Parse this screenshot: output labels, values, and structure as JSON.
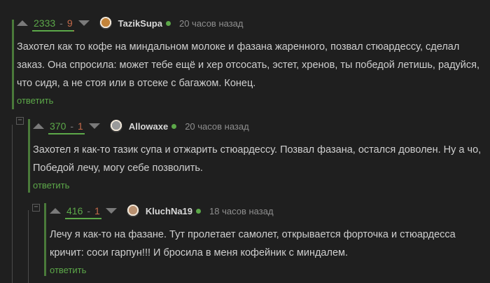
{
  "comments": [
    {
      "rating_up": "2333",
      "rating_sep": "-",
      "rating_down": "9",
      "rating_fraction": 0.996,
      "username": "TazikSupa",
      "time": "20 часов назад",
      "text_lines": [
        "Захотел как то кофе на миндальном молоке и фазана жаренного, позвал стюардессу, сделал",
        "заказ. Она спросила: может тебе ещё и хер отсосать, эстет, хренов, ты победой летишь, радуйся,",
        "что сидя, а не стоя или в отсеке с багажом. Конец."
      ],
      "reply_label": "ответить",
      "avatar_color": "#c4843a"
    },
    {
      "rating_up": "370",
      "rating_sep": "-",
      "rating_down": "1",
      "rating_fraction": 0.997,
      "username": "Allowaxe",
      "time": "20 часов назад",
      "text_lines": [
        "Захотел я как-то тазик супа и отжарить стюардессу. Позвал фазана, остался доволен. Ну а чо,",
        "Победой лечу, могу себе позволить."
      ],
      "reply_label": "ответить",
      "avatar_color": "#9a9a9a"
    },
    {
      "rating_up": "416",
      "rating_sep": "-",
      "rating_down": "1",
      "rating_fraction": 0.998,
      "username": "KluchNa19",
      "time": "18 часов назад",
      "text_lines": [
        "Лечу я как-то на фазане. Тут пролетает самолет, открывается форточка и стюардесса",
        "кричит: соси гарпун!!! И бросила в меня кофейник с миндалем."
      ],
      "reply_label": "ответить",
      "avatar_color": "#b89070"
    }
  ],
  "collapse_symbol": "−"
}
